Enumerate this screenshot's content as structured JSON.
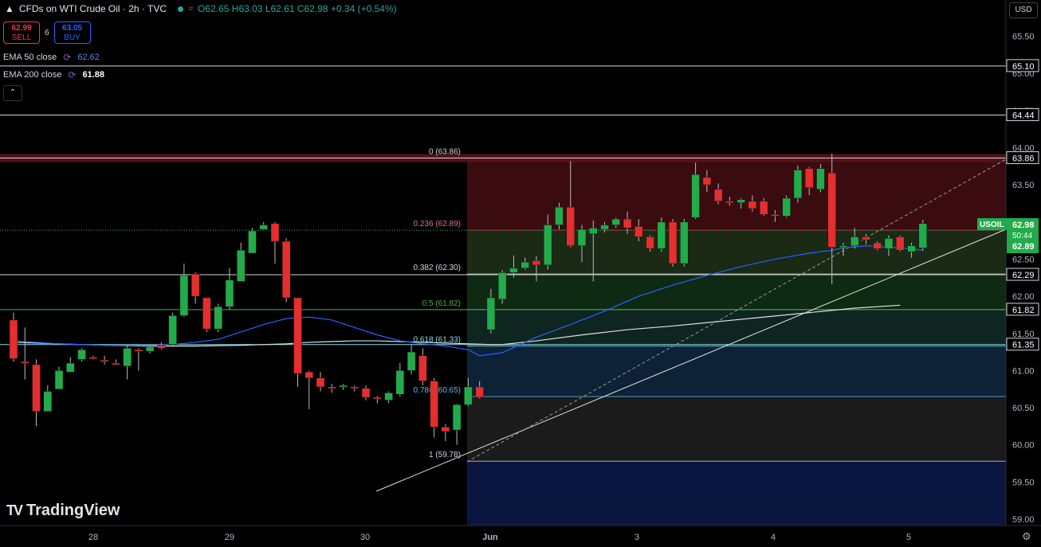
{
  "header": {
    "symbol": "CFDs on WTI Crude Oil · 2h · TVC",
    "ohlc": "O62.65 H63.03 L62.61 C62.98 +0.34 (+0.54%)"
  },
  "trade": {
    "sell_price": "62.99",
    "sell_label": "SELL",
    "spread": "6",
    "buy_price": "63.05",
    "buy_label": "BUY"
  },
  "indicators": [
    {
      "label": "EMA 50 close",
      "value": "62.62",
      "color": "#2962ff"
    },
    {
      "label": "EMA 200 close",
      "value": "61.88",
      "color": "#e0e0e0"
    }
  ],
  "currency": "USD",
  "brand": "TradingView",
  "colors": {
    "up": "#22ab4a",
    "down": "#e52e2e",
    "bg": "#000000"
  },
  "chart_data": {
    "type": "candlestick",
    "symbol": "USOIL",
    "timeframe": "2h",
    "x_labels": [
      "28",
      "29",
      "30",
      "Jun",
      "3",
      "4",
      "5"
    ],
    "y_ticks": [
      "65.50",
      "65.00",
      "64.50",
      "64.00",
      "63.50",
      "63.00",
      "62.50",
      "62.00",
      "61.50",
      "61.00",
      "60.50",
      "60.00",
      "59.50",
      "59.00"
    ],
    "ylim": [
      58.95,
      65.95
    ],
    "candles": [
      {
        "o": 61.68,
        "h": 61.78,
        "l": 61.12,
        "c": 61.16
      },
      {
        "o": 61.12,
        "h": 61.58,
        "l": 60.88,
        "c": 61.1
      },
      {
        "o": 61.08,
        "h": 61.15,
        "l": 60.25,
        "c": 60.45
      },
      {
        "o": 60.45,
        "h": 60.8,
        "l": 60.45,
        "c": 60.72
      },
      {
        "o": 60.75,
        "h": 61.05,
        "l": 60.75,
        "c": 61.0
      },
      {
        "o": 60.98,
        "h": 61.18,
        "l": 60.98,
        "c": 61.1
      },
      {
        "o": 61.15,
        "h": 61.3,
        "l": 61.12,
        "c": 61.28
      },
      {
        "o": 61.18,
        "h": 61.2,
        "l": 61.15,
        "c": 61.16
      },
      {
        "o": 61.14,
        "h": 61.2,
        "l": 61.08,
        "c": 61.12
      },
      {
        "o": 61.1,
        "h": 61.15,
        "l": 61.07,
        "c": 61.08
      },
      {
        "o": 61.06,
        "h": 61.34,
        "l": 60.88,
        "c": 61.3
      },
      {
        "o": 61.28,
        "h": 61.3,
        "l": 61.0,
        "c": 61.26
      },
      {
        "o": 61.26,
        "h": 61.34,
        "l": 61.23,
        "c": 61.32
      },
      {
        "o": 61.34,
        "h": 61.38,
        "l": 61.28,
        "c": 61.3
      },
      {
        "o": 61.35,
        "h": 61.78,
        "l": 61.32,
        "c": 61.74
      },
      {
        "o": 61.74,
        "h": 62.44,
        "l": 61.72,
        "c": 62.28
      },
      {
        "o": 62.3,
        "h": 62.32,
        "l": 61.9,
        "c": 62.0
      },
      {
        "o": 61.98,
        "h": 61.98,
        "l": 61.52,
        "c": 61.56
      },
      {
        "o": 61.56,
        "h": 61.9,
        "l": 61.52,
        "c": 61.86
      },
      {
        "o": 61.86,
        "h": 62.38,
        "l": 61.82,
        "c": 62.22
      },
      {
        "o": 62.2,
        "h": 62.72,
        "l": 62.2,
        "c": 62.62
      },
      {
        "o": 62.58,
        "h": 62.92,
        "l": 62.58,
        "c": 62.88
      },
      {
        "o": 62.9,
        "h": 63.0,
        "l": 62.9,
        "c": 62.96
      },
      {
        "o": 62.98,
        "h": 63.0,
        "l": 62.44,
        "c": 62.74
      },
      {
        "o": 62.74,
        "h": 62.78,
        "l": 61.92,
        "c": 61.98
      },
      {
        "o": 61.98,
        "h": 61.98,
        "l": 60.78,
        "c": 60.96
      },
      {
        "o": 60.98,
        "h": 61.0,
        "l": 60.48,
        "c": 60.9
      },
      {
        "o": 60.9,
        "h": 60.98,
        "l": 60.72,
        "c": 60.78
      },
      {
        "o": 60.78,
        "h": 60.82,
        "l": 60.7,
        "c": 60.76
      },
      {
        "o": 60.78,
        "h": 60.82,
        "l": 60.74,
        "c": 60.8
      },
      {
        "o": 60.78,
        "h": 60.8,
        "l": 60.72,
        "c": 60.76
      },
      {
        "o": 60.76,
        "h": 60.8,
        "l": 60.6,
        "c": 60.64
      },
      {
        "o": 60.64,
        "h": 60.66,
        "l": 60.56,
        "c": 60.62
      },
      {
        "o": 60.6,
        "h": 60.72,
        "l": 60.56,
        "c": 60.7
      },
      {
        "o": 60.68,
        "h": 61.1,
        "l": 60.65,
        "c": 61.0
      },
      {
        "o": 61.0,
        "h": 61.35,
        "l": 60.95,
        "c": 61.25
      },
      {
        "o": 61.2,
        "h": 61.3,
        "l": 60.8,
        "c": 60.86
      },
      {
        "o": 60.86,
        "h": 60.9,
        "l": 60.1,
        "c": 60.24
      },
      {
        "o": 60.24,
        "h": 60.28,
        "l": 60.05,
        "c": 60.18
      },
      {
        "o": 60.2,
        "h": 60.55,
        "l": 60.0,
        "c": 60.54
      },
      {
        "o": 60.54,
        "h": 60.9,
        "l": 60.52,
        "c": 60.78
      },
      {
        "o": 60.78,
        "h": 60.86,
        "l": 60.62,
        "c": 60.64
      },
      {
        "o": 61.55,
        "h": 62.1,
        "l": 61.5,
        "c": 61.98
      },
      {
        "o": 61.96,
        "h": 62.35,
        "l": 61.9,
        "c": 62.32
      },
      {
        "o": 62.32,
        "h": 62.55,
        "l": 62.25,
        "c": 62.38
      },
      {
        "o": 62.38,
        "h": 62.52,
        "l": 62.36,
        "c": 62.46
      },
      {
        "o": 62.48,
        "h": 62.54,
        "l": 62.2,
        "c": 62.42
      },
      {
        "o": 62.42,
        "h": 63.1,
        "l": 62.36,
        "c": 62.96
      },
      {
        "o": 62.96,
        "h": 63.26,
        "l": 62.9,
        "c": 63.2
      },
      {
        "o": 63.2,
        "h": 63.82,
        "l": 62.66,
        "c": 62.68
      },
      {
        "o": 62.68,
        "h": 62.96,
        "l": 62.46,
        "c": 62.9
      },
      {
        "o": 62.84,
        "h": 63.02,
        "l": 62.2,
        "c": 62.92
      },
      {
        "o": 62.9,
        "h": 63.0,
        "l": 62.86,
        "c": 62.96
      },
      {
        "o": 62.96,
        "h": 63.06,
        "l": 62.92,
        "c": 63.04
      },
      {
        "o": 63.04,
        "h": 63.14,
        "l": 62.84,
        "c": 62.92
      },
      {
        "o": 62.94,
        "h": 63.04,
        "l": 62.74,
        "c": 62.8
      },
      {
        "o": 62.8,
        "h": 62.82,
        "l": 62.6,
        "c": 62.64
      },
      {
        "o": 62.64,
        "h": 63.06,
        "l": 62.6,
        "c": 63.0
      },
      {
        "o": 63.0,
        "h": 63.04,
        "l": 62.4,
        "c": 62.44
      },
      {
        "o": 62.44,
        "h": 63.04,
        "l": 62.4,
        "c": 63.0
      },
      {
        "o": 63.06,
        "h": 63.8,
        "l": 63.04,
        "c": 63.64
      },
      {
        "o": 63.6,
        "h": 63.7,
        "l": 63.4,
        "c": 63.5
      },
      {
        "o": 63.44,
        "h": 63.52,
        "l": 63.24,
        "c": 63.28
      },
      {
        "o": 63.28,
        "h": 63.34,
        "l": 63.22,
        "c": 63.26
      },
      {
        "o": 63.26,
        "h": 63.32,
        "l": 63.18,
        "c": 63.3
      },
      {
        "o": 63.28,
        "h": 63.36,
        "l": 63.14,
        "c": 63.18
      },
      {
        "o": 63.28,
        "h": 63.32,
        "l": 63.08,
        "c": 63.1
      },
      {
        "o": 63.1,
        "h": 63.16,
        "l": 63.0,
        "c": 63.08
      },
      {
        "o": 63.08,
        "h": 63.36,
        "l": 63.06,
        "c": 63.32
      },
      {
        "o": 63.32,
        "h": 63.76,
        "l": 63.26,
        "c": 63.7
      },
      {
        "o": 63.72,
        "h": 63.74,
        "l": 63.36,
        "c": 63.46
      },
      {
        "o": 63.44,
        "h": 63.78,
        "l": 63.4,
        "c": 63.72
      },
      {
        "o": 63.66,
        "h": 63.92,
        "l": 62.16,
        "c": 62.66
      },
      {
        "o": 62.66,
        "h": 62.72,
        "l": 62.54,
        "c": 62.68
      },
      {
        "o": 62.68,
        "h": 62.92,
        "l": 62.64,
        "c": 62.8
      },
      {
        "o": 62.8,
        "h": 62.84,
        "l": 62.7,
        "c": 62.76
      },
      {
        "o": 62.72,
        "h": 62.74,
        "l": 62.62,
        "c": 62.64
      },
      {
        "o": 62.64,
        "h": 62.82,
        "l": 62.54,
        "c": 62.78
      },
      {
        "o": 62.8,
        "h": 62.82,
        "l": 62.6,
        "c": 62.62
      },
      {
        "o": 62.6,
        "h": 62.72,
        "l": 62.52,
        "c": 62.68
      },
      {
        "o": 62.65,
        "h": 63.03,
        "l": 62.61,
        "c": 62.98
      }
    ],
    "ema50": [
      61.4,
      61.38,
      61.36,
      61.35,
      61.34,
      61.34,
      61.34,
      61.35,
      61.38,
      61.42,
      61.52,
      61.62,
      61.7,
      61.72,
      61.68,
      61.58,
      61.48,
      61.4,
      61.36,
      61.33,
      61.28,
      61.2,
      61.24,
      61.45,
      61.62,
      61.8,
      62.0,
      62.15,
      62.28,
      62.4,
      62.5,
      62.58,
      62.62,
      62.65,
      62.68,
      62.66,
      62.64,
      62.62
    ],
    "ema50_x": [
      0,
      2,
      4,
      6,
      8,
      10,
      12,
      14,
      16,
      18,
      20,
      22,
      24,
      26,
      28,
      30,
      32,
      34,
      36,
      38,
      40,
      41,
      43,
      46,
      49,
      52,
      55,
      58,
      61,
      64,
      67,
      70,
      72,
      73,
      75,
      77,
      79,
      80
    ],
    "ema200": [
      61.38,
      61.36,
      61.34,
      61.33,
      61.33,
      61.34,
      61.36,
      61.38,
      61.39,
      61.4,
      61.4,
      61.39,
      61.38,
      61.37,
      61.36,
      61.35,
      61.35,
      61.4,
      61.48,
      61.55,
      61.6,
      61.66,
      61.72,
      61.78,
      61.84,
      61.88
    ],
    "ema200_x": [
      0,
      4,
      8,
      12,
      16,
      20,
      24,
      26,
      28,
      30,
      32,
      34,
      36,
      38,
      40,
      42,
      43,
      46,
      50,
      54,
      58,
      62,
      66,
      70,
      74,
      78
    ],
    "fibonacci": [
      {
        "ratio": "0",
        "price": 63.86,
        "label": "0 (63.86)"
      },
      {
        "ratio": "0.236",
        "price": 62.89,
        "label": "0.236 (62.89)"
      },
      {
        "ratio": "0.382",
        "price": 62.3,
        "label": "0.382 (62.30)"
      },
      {
        "ratio": "0.5",
        "price": 61.82,
        "label": "0.5 (61.82)"
      },
      {
        "ratio": "0.618",
        "price": 61.33,
        "label": "0.618 (61.33)"
      },
      {
        "ratio": "0.786",
        "price": 60.65,
        "label": "0.786 (60.65)"
      },
      {
        "ratio": "1",
        "price": 59.78,
        "label": "1 (59.78)"
      }
    ],
    "horizontal_levels": [
      65.1,
      64.44,
      63.86,
      62.29,
      61.82,
      61.35
    ],
    "price_labels": [
      "65.10",
      "64.44",
      "63.86",
      "62.29",
      "61.82",
      "61.35"
    ],
    "last_price": {
      "symbol": "USOIL",
      "price": "62.98",
      "countdown": "50:44",
      "level": "62.89"
    }
  }
}
